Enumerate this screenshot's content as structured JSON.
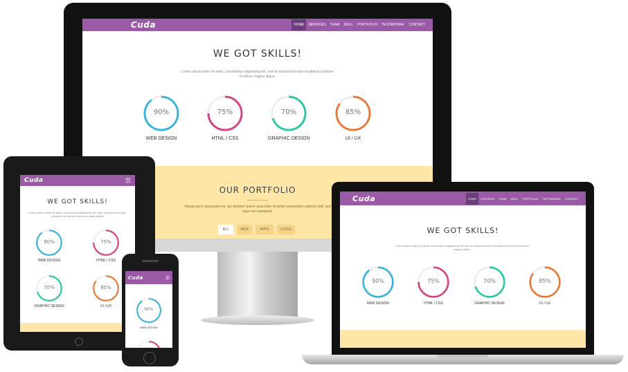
{
  "brand": {
    "logo": "Cuda"
  },
  "nav": {
    "items": [
      "Home",
      "Services",
      "Team",
      "Skill",
      "Portfolio",
      "Testimonial",
      "Contact"
    ],
    "active": "Home"
  },
  "skills_section": {
    "title": "WE GOT SKILLS!",
    "description": "Lorem ipsum dolor sit amet, consectetur adipisicing elit, sed do eiusmod tempor incididunt ut labore et dolore magna aliqua.",
    "items": [
      {
        "label": "Web Design",
        "percent": 90,
        "percent_text": "90%",
        "color": "#3bb3dc"
      },
      {
        "label": "HTML / CSS",
        "percent": 75,
        "percent_text": "75%",
        "color": "#d2457f"
      },
      {
        "label": "Graphic Design",
        "percent": 70,
        "percent_text": "70%",
        "color": "#2ec7a6"
      },
      {
        "label": "UI / UX",
        "percent": 85,
        "percent_text": "85%",
        "color": "#e87a3c"
      }
    ]
  },
  "portfolio_section": {
    "title": "OUR PORTFOLIO",
    "description": "Neque porro quisquam est, qui dolorem ipsum quia dolor sit amet consectetur adipisci velit, sed quia non numquam",
    "filters": [
      "All",
      "Web",
      "Apps",
      "Icons"
    ],
    "active_filter": "All"
  },
  "colors": {
    "nav": "#9a5aa6",
    "nav_active": "#6b3f7a",
    "portfolio_bg": "#fde6a6",
    "device_frame": "#1a1a1a"
  }
}
